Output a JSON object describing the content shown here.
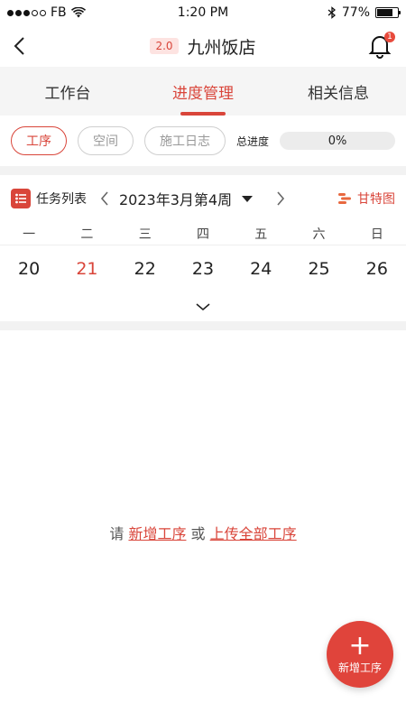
{
  "status_bar": {
    "carrier": "FB",
    "time": "1:20 PM",
    "battery": "77%",
    "battery_level": 0.77
  },
  "nav": {
    "version": "2.0",
    "title": "九州饭店",
    "notification_count": "1"
  },
  "tabs": [
    {
      "label": "工作台",
      "active": false
    },
    {
      "label": "进度管理",
      "active": true
    },
    {
      "label": "相关信息",
      "active": false
    }
  ],
  "filters": [
    {
      "label": "工序",
      "active": true
    },
    {
      "label": "空间",
      "active": false
    },
    {
      "label": "施工日志",
      "active": false
    }
  ],
  "progress": {
    "label": "总进度",
    "value_text": "0%",
    "value": 0
  },
  "week": {
    "task_list_label": "任务列表",
    "label": "2023年3月第4周",
    "gantt_label": "甘特图",
    "weekdays": [
      "一",
      "二",
      "三",
      "四",
      "五",
      "六",
      "日"
    ],
    "dates": [
      "20",
      "21",
      "22",
      "23",
      "24",
      "25",
      "26"
    ],
    "today_index": 1
  },
  "empty": {
    "prefix": "请",
    "link_add": "新增工序",
    "middle": "或",
    "link_upload": "上传全部工序"
  },
  "fab": {
    "label": "新增工序"
  },
  "colors": {
    "accent": "#d9453a"
  }
}
